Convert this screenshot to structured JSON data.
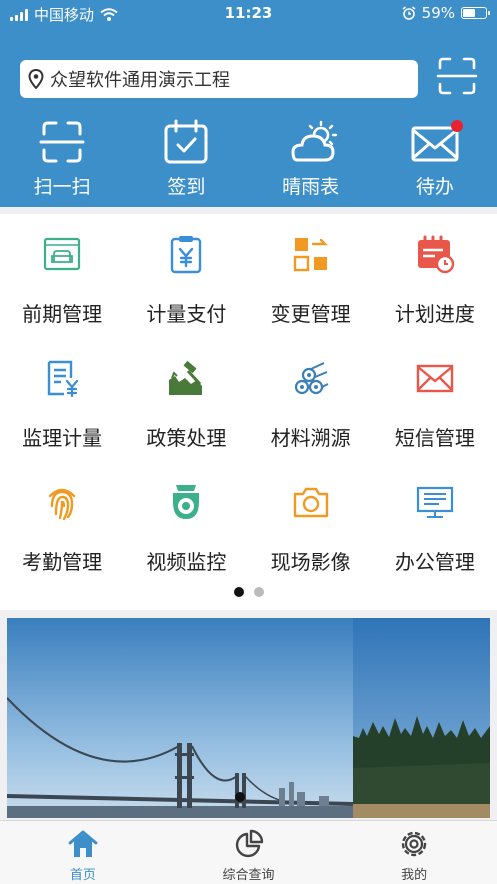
{
  "status_bar": {
    "carrier": "中国移动",
    "time": "11:23",
    "battery": "59%",
    "battery_level": 0.59
  },
  "search": {
    "value": "众望软件通用演示工程",
    "icons": [
      "location-icon",
      "scan-icon"
    ]
  },
  "quick_actions": [
    {
      "label": "扫一扫",
      "icon": "scan-icon"
    },
    {
      "label": "签到",
      "icon": "calendar-check-icon"
    },
    {
      "label": "晴雨表",
      "icon": "weather-icon"
    },
    {
      "label": "待办",
      "icon": "mail-icon",
      "badge": true
    }
  ],
  "modules": [
    {
      "label": "前期管理",
      "icon": "sofa-icon",
      "color": "#3bb08a"
    },
    {
      "label": "计量支付",
      "icon": "clipboard-yen-icon",
      "color": "#3a8fd8"
    },
    {
      "label": "变更管理",
      "icon": "swap-blocks-icon",
      "color": "#f19a22"
    },
    {
      "label": "计划进度",
      "icon": "calendar-clock-icon",
      "color": "#e8574a"
    },
    {
      "label": "监理计量",
      "icon": "doc-yen-icon",
      "color": "#3a8fd8"
    },
    {
      "label": "政策处理",
      "icon": "gavel-icon",
      "color": "#4a7a3a"
    },
    {
      "label": "材料溯源",
      "icon": "logs-icon",
      "color": "#3a7fb8"
    },
    {
      "label": "短信管理",
      "icon": "envelope-icon",
      "color": "#e8574a"
    },
    {
      "label": "考勤管理",
      "icon": "fingerprint-icon",
      "color": "#f19a22"
    },
    {
      "label": "视频监控",
      "icon": "camera-dome-icon",
      "color": "#3bb08a"
    },
    {
      "label": "现场影像",
      "icon": "camera-icon",
      "color": "#f19a22"
    },
    {
      "label": "办公管理",
      "icon": "monitor-icon",
      "color": "#3a8fd8"
    }
  ],
  "pager": {
    "pages": 2,
    "current": 1
  },
  "banner": {
    "slides": [
      "bridge-photo",
      "forest-photo"
    ],
    "current": 1
  },
  "tab_bar": [
    {
      "label": "首页",
      "icon": "home-icon",
      "active": true
    },
    {
      "label": "综合查询",
      "icon": "pie-chart-icon",
      "active": false
    },
    {
      "label": "我的",
      "icon": "gear-icon",
      "active": false
    }
  ],
  "colors": {
    "header_blue": "#3d8fc9",
    "badge_red": "#e8232f",
    "active_tab": "#3d8fc9"
  }
}
